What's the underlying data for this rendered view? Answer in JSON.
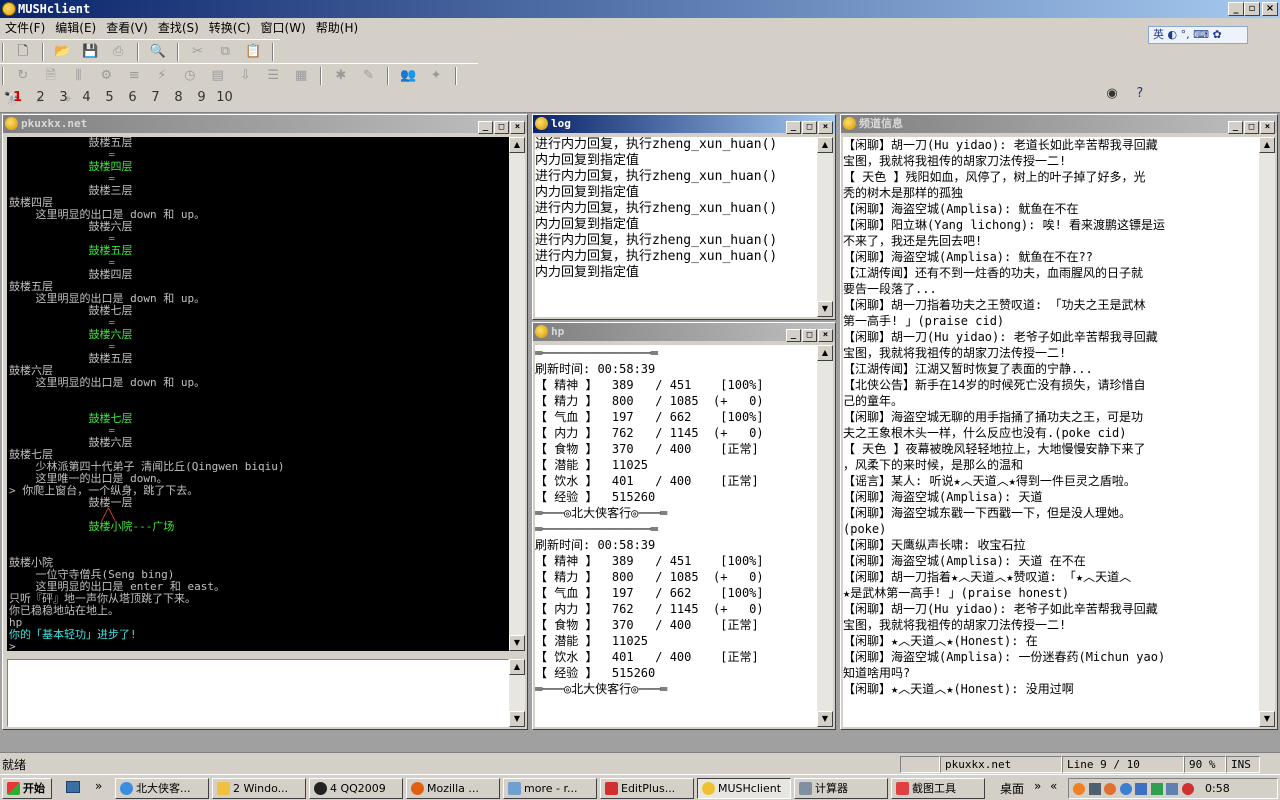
{
  "window": {
    "title": "MUSHclient",
    "min": "_",
    "max": "▫",
    "close": "×"
  },
  "menu": [
    "文件(F)",
    "编辑(E)",
    "查看(V)",
    "查找(S)",
    "转换(C)",
    "窗口(W)",
    "帮助(H)"
  ],
  "ime_label": "英 ◐ °, ⌨ ✿",
  "world_numbers": [
    "1",
    "2",
    "3",
    "4",
    "5",
    "6",
    "7",
    "8",
    "9",
    "10"
  ],
  "panes": {
    "main": {
      "title": "pkuxkx.net",
      "lines": [
        {
          "t": "            鼓楼五层"
        },
        {
          "t": "               =",
          "c": "blue"
        },
        {
          "t": "            鼓楼四层",
          "c": "green"
        },
        {
          "t": "               =",
          "c": "blue"
        },
        {
          "t": "            鼓楼三层"
        },
        {
          "t": "鼓楼四层"
        },
        {
          "t": "    这里明显的出口是 down 和 up。"
        },
        {
          "t": "            鼓楼六层"
        },
        {
          "t": "               =",
          "c": "blue"
        },
        {
          "t": "            鼓楼五层",
          "c": "green"
        },
        {
          "t": "               =",
          "c": "blue"
        },
        {
          "t": "            鼓楼四层"
        },
        {
          "t": "鼓楼五层"
        },
        {
          "t": "    这里明显的出口是 down 和 up。"
        },
        {
          "t": "            鼓楼七层"
        },
        {
          "t": "               =",
          "c": "blue"
        },
        {
          "t": "            鼓楼六层",
          "c": "green"
        },
        {
          "t": "               =",
          "c": "blue"
        },
        {
          "t": "            鼓楼五层"
        },
        {
          "t": "鼓楼六层"
        },
        {
          "t": "    这里明显的出口是 down 和 up。"
        },
        {
          "t": ""
        },
        {
          "t": ""
        },
        {
          "t": "            鼓楼七层",
          "c": "green"
        },
        {
          "t": "               =",
          "c": "blue"
        },
        {
          "t": "            鼓楼六层"
        },
        {
          "t": "鼓楼七层"
        },
        {
          "t": "    少林派第四十代弟子 清闻比丘(Qingwen biqiu)"
        },
        {
          "t": "    这里唯一的出口是 down。"
        },
        {
          "t": "> 你爬上窗台，一个纵身，跳了下去。"
        },
        {
          "t": "            鼓楼一层"
        },
        {
          "t": "              ╱╲",
          "c": "red"
        },
        {
          "t": "            鼓楼小院---广场",
          "c": "green"
        },
        {
          "t": ""
        },
        {
          "t": ""
        },
        {
          "t": "鼓楼小院"
        },
        {
          "t": "    一位守寺僧兵(Seng bing)"
        },
        {
          "t": "    这里明显的出口是 enter 和 east。"
        },
        {
          "t": "只听『砰』地一声你从塔顶跳了下来。"
        },
        {
          "t": "你已稳稳地站在地上。"
        },
        {
          "t": "hp"
        },
        {
          "t": "你的「基本轻功」进步了!",
          "c": "cyan"
        },
        {
          "t": ">"
        }
      ]
    },
    "log": {
      "title": "log",
      "lines": [
        "进行内力回复，执行zheng_xun_huan()",
        "内力回复到指定值",
        "进行内力回复，执行zheng_xun_huan()",
        "内力回复到指定值",
        "进行内力回复，执行zheng_xun_huan()",
        "内力回复到指定值",
        "进行内力回复，执行zheng_xun_huan()",
        "进行内力回复，执行zheng_xun_huan()",
        "内力回复到指定值"
      ]
    },
    "hp": {
      "title": "hp",
      "lines": [
        "═───────────────═",
        "刷新时间: 00:58:39",
        "【 精神 】  389   / 451    [100%]",
        "【 精力 】  800   / 1085  (+   0)",
        "【 气血 】  197   / 662    [100%]",
        "【 内力 】  762   / 1145  (+   0)",
        "【 食物 】  370   / 400    [正常]",
        "【 潜能 】  11025",
        "【 饮水 】  401   / 400    [正常]",
        "【 经验 】  515260",
        "═───◎北大侠客行◎───═",
        "═───────────────═",
        "刷新时间: 00:58:39",
        "【 精神 】  389   / 451    [100%]",
        "【 精力 】  800   / 1085  (+   0)",
        "【 气血 】  197   / 662    [100%]",
        "【 内力 】  762   / 1145  (+   0)",
        "【 食物 】  370   / 400    [正常]",
        "【 潜能 】  11025",
        "【 饮水 】  401   / 400    [正常]",
        "【 经验 】  515260",
        "═───◎北大侠客行◎───═"
      ]
    },
    "channel": {
      "title": "频道信息",
      "lines": [
        "【闲聊】胡一刀(Hu yidao): 老道长如此辛苦帮我寻回藏",
        "宝图，我就将我祖传的胡家刀法传授一二!",
        "【 天色 】残阳如血，风停了，树上的叶子掉了好多，光",
        "秃的树木是那样的孤独",
        "【闲聊】海盗空城(Amplisa): 鱿鱼在不在",
        "【闲聊】阳立琳(Yang lichong): 唉! 看来渡鹏这镖是运",
        "不来了，我还是先回去吧!",
        "【闲聊】海盗空城(Amplisa): 鱿鱼在不在??",
        "【江湖传闻】还有不到一炷香的功夫，血雨腥风的日子就",
        "要告一段落了...",
        "【闲聊】胡一刀指着功夫之王赞叹道: 「功夫之王是武林",
        "第一高手! 」(praise cid)",
        "【闲聊】胡一刀(Hu yidao): 老爷子如此辛苦帮我寻回藏",
        "宝图，我就将我祖传的胡家刀法传授一二!",
        "【江湖传闻】江湖又暂时恢复了表面的宁静...",
        "【北侠公告】新手在14岁的时候死亡没有损失，请珍惜自",
        "己的童年。",
        "【闲聊】海盗空城无聊的用手指捅了捅功夫之王，可是功",
        "夫之王象根木头一样，什么反应也没有.(poke cid)",
        "【 天色 】夜幕被晚风轻轻地拉上，大地慢慢安静下来了",
        "，风柔下的来时候，是那么的温和",
        "【谣言】某人: 听说★︿天道︿★得到一件巨灵之盾啦。",
        "【闲聊】海盗空城(Amplisa): 天道",
        "【闲聊】海盗空城东戳一下西戳一下，但是没人理她。",
        "(poke)",
        "【闲聊】天鹰纵声长啸: 收宝石拉",
        "【闲聊】海盗空城(Amplisa): 天道 在不在",
        "【闲聊】胡一刀指着★︿天道︿★赞叹道: 「★︿天道︿",
        "★是武林第一高手! 」(praise honest)",
        "【闲聊】胡一刀(Hu yidao): 老爷子如此辛苦帮我寻回藏",
        "宝图，我就将我祖传的胡家刀法传授一二!",
        "【闲聊】★︿天道︿★(Honest): 在",
        "【闲聊】海盗空城(Amplisa): 一份迷春药(Michun yao)",
        "知道啥用吗?",
        "【闲聊】★︿天道︿★(Honest): 没用过啊"
      ]
    }
  },
  "status": {
    "ready": "就绪",
    "world": "pkuxkx.net",
    "line": "Line 9 / 10",
    "zoom": "90 %",
    "mode": "INS"
  },
  "taskbar": {
    "start": "开始",
    "chevron": "»",
    "items": [
      "北大侠客...",
      "2 Windo...",
      "4 QQ2009",
      "Mozilla ...",
      "more - r...",
      "EditPlus...",
      "MUSHclient",
      "计算器",
      "截图工具"
    ],
    "desktop": "桌面",
    "clock": "0:58"
  }
}
